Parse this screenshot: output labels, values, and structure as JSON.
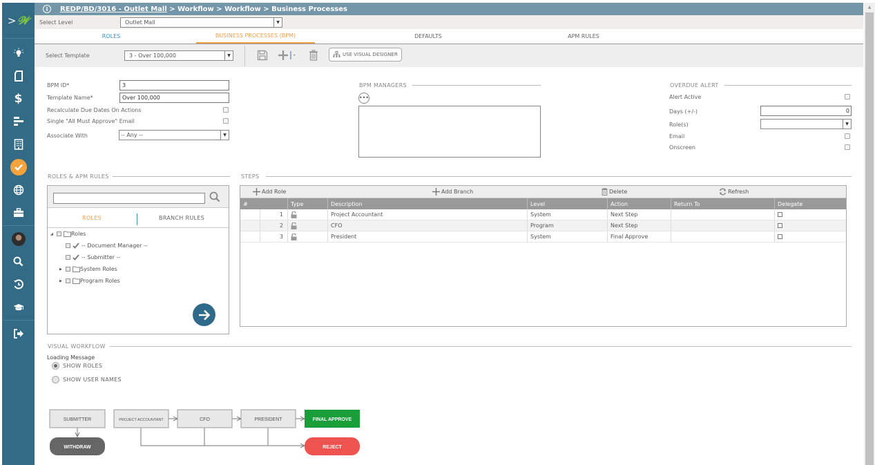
{
  "header": {
    "info_icon": "info-icon",
    "crumb_link": "REDP/BD/3016 - Outlet Mall",
    "crumb_rest": " > Workflow > Workflow > Business Processes"
  },
  "level": {
    "label": "Select Level",
    "value": "Outlet Mall"
  },
  "tabs": [
    {
      "label": "ROLES",
      "active": false
    },
    {
      "label": "BUSINESS PROCESSES (BPM)",
      "active": true
    },
    {
      "label": "DEFAULTS",
      "active": false
    },
    {
      "label": "APM RULES",
      "active": false
    }
  ],
  "toolbar": {
    "template_label": "Select Template",
    "template_value": "3 - Over 100,000",
    "visual_designer_label": "USE VISUAL DESIGNER",
    "icons": [
      "save-icon",
      "add-icon",
      "delete-icon",
      "hierarchy-icon"
    ]
  },
  "form": {
    "bpm_id_label": "BPM ID*",
    "bpm_id_value": "3",
    "template_name_label": "Template Name*",
    "template_name_value": "Over 100,000",
    "recalc_label": "Recalculate Due Dates On Actions",
    "recalc_checked": false,
    "single_email_label": "Single \"All Must Approve\" Email",
    "single_email_checked": false,
    "associate_label": "Associate With",
    "associate_value": "-- Any --"
  },
  "managers": {
    "title": "BPM MANAGERS",
    "more_label": "•••"
  },
  "overdue": {
    "title": "OVERDUE ALERT",
    "alert_active_label": "Alert Active",
    "alert_active_checked": false,
    "days_label": "Days (+/-)",
    "days_value": "0",
    "roles_label": "Role(s)",
    "roles_value": "",
    "email_label": "Email",
    "email_checked": false,
    "onscreen_label": "Onscreen",
    "onscreen_checked": false
  },
  "roles_panel": {
    "title": "ROLES & APM RULES",
    "search_value": "",
    "tab_roles": "ROLES",
    "tab_branch": "BRANCH RULES",
    "tree": [
      {
        "label": "Roles",
        "type": "folder",
        "expanded": true,
        "level": 0
      },
      {
        "label": "-- Document Manager --",
        "type": "check",
        "level": 1
      },
      {
        "label": "-- Submitter --",
        "type": "check",
        "level": 1
      },
      {
        "label": "System Roles",
        "type": "folder",
        "expanded": false,
        "level": 1
      },
      {
        "label": "Program Roles",
        "type": "folder",
        "expanded": false,
        "level": 1
      }
    ]
  },
  "steps": {
    "title": "STEPS",
    "add_role": "Add Role",
    "add_branch": "Add Branch",
    "delete": "Delete",
    "refresh": "Refresh",
    "columns": [
      "#",
      "Type",
      "Description",
      "Level",
      "Action",
      "Return To",
      "Delegate"
    ],
    "rows": [
      {
        "num": "1",
        "type": "unlock-icon",
        "description": "Project Accountant",
        "level": "System",
        "action": "Next Step",
        "return_to": "",
        "delegate": false
      },
      {
        "num": "2",
        "type": "unlock-icon",
        "description": "CFO",
        "level": "Program",
        "action": "Next Step",
        "return_to": "",
        "delegate": false
      },
      {
        "num": "3",
        "type": "unlock-icon",
        "description": "President",
        "level": "System",
        "action": "Final Approve",
        "return_to": "",
        "delegate": false
      }
    ]
  },
  "visual_workflow": {
    "title": "VISUAL WORKFLOW",
    "loading_message": "Loading Message",
    "options": [
      {
        "label": "SHOW ROLES",
        "selected": true
      },
      {
        "label": "SHOW USER NAMES",
        "selected": false
      }
    ],
    "nodes": {
      "submitter": "SUBMITTER",
      "withdraw": "WITHDRAW",
      "project_accountant": "PROJECT ACCOUNTANT",
      "cfo": "CFO",
      "president": "PRESIDENT",
      "final_approve": "FINAL APPROVE",
      "reject": "REJECT"
    },
    "colors": {
      "step": "#e8e8e8",
      "withdraw": "#666666",
      "final_approve": "#1a9e3a",
      "reject": "#ef5350"
    }
  },
  "sidebar": {
    "items": [
      "lightbulb-icon",
      "document-icon",
      "dollar-icon",
      "bar-chart-icon",
      "building-icon",
      "check-circle-icon",
      "globe-icon",
      "briefcase-icon",
      "avatar",
      "search-icon",
      "history-icon",
      "graduation-cap-icon",
      "logout-icon"
    ],
    "accent": "#f5a33c"
  }
}
